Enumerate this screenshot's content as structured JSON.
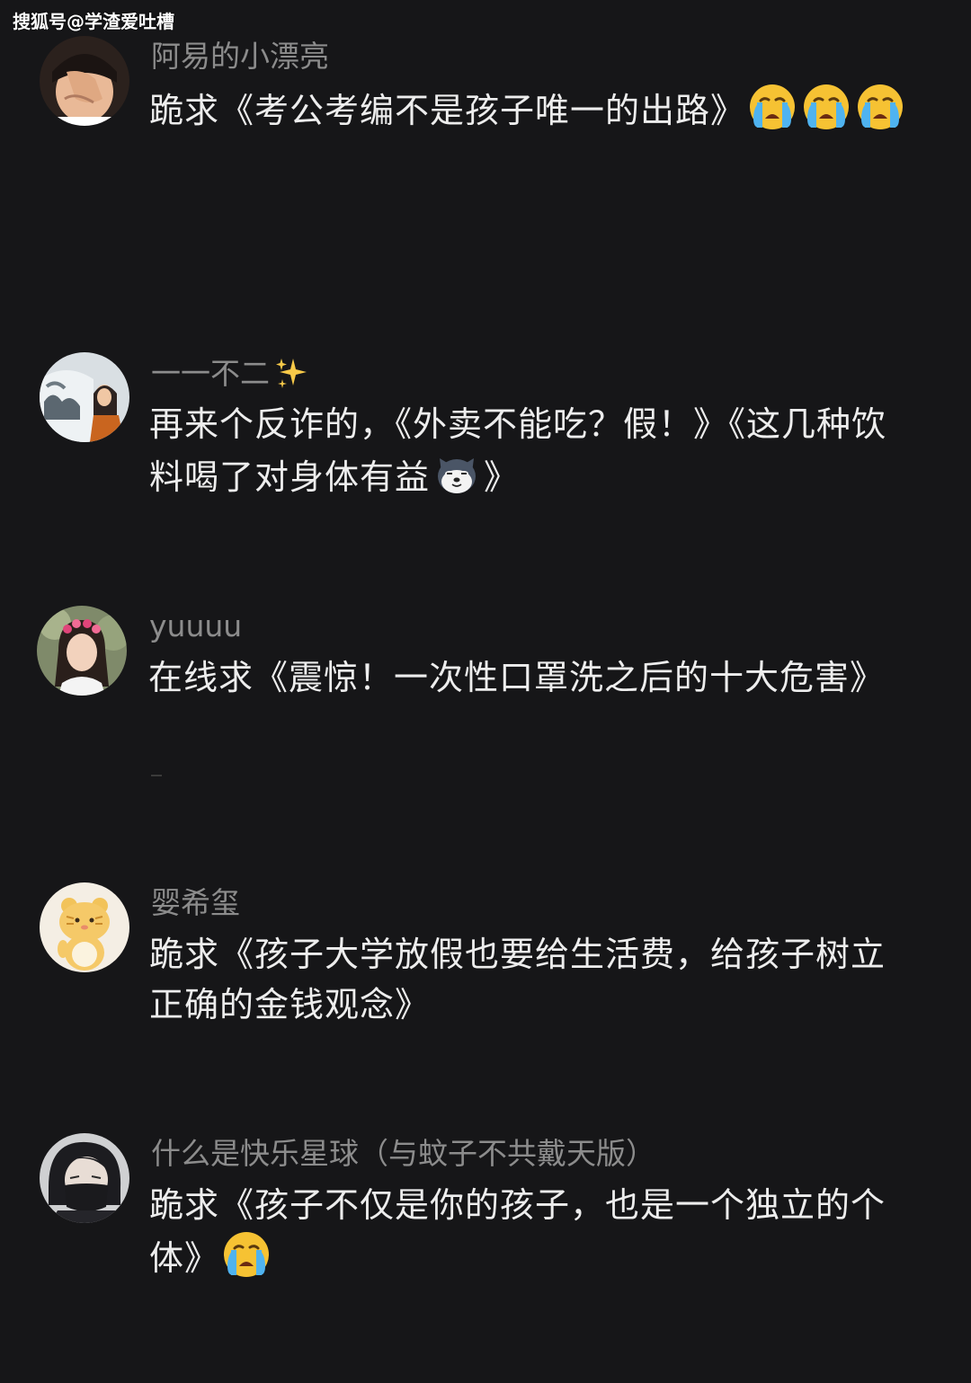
{
  "watermark": "搜狐号@学渣爱吐槽",
  "comments": [
    {
      "username": "阿易的小漂亮",
      "text": "跪求《考公考编不是孩子唯一的出路》",
      "emojis": [
        "crying-face",
        "crying-face",
        "crying-face"
      ]
    },
    {
      "username": "一一不二",
      "username_emoji": "sparkles",
      "text_part1": "再来个反诈的，《外卖不能吃？假！》《这几种饮料喝了对身体有益",
      "text_emoji": "husky-dog-face",
      "text_part2": "》"
    },
    {
      "username": "yuuuu",
      "text": "在线求《震惊！一次性口罩洗之后的十大危害》"
    },
    {
      "username": "婴希玺",
      "text": "跪求《孩子大学放假也要给生活费，给孩子树立正确的金钱观念》"
    },
    {
      "username": "什么是快乐星球（与蚊子不共戴天版）",
      "text": "跪求《孩子不仅是你的孩子，也是一个独立的个体》",
      "emojis": [
        "crying-face"
      ]
    }
  ],
  "colors": {
    "background": "#161618",
    "username": "#8c8c8c",
    "text": "#ededed"
  }
}
